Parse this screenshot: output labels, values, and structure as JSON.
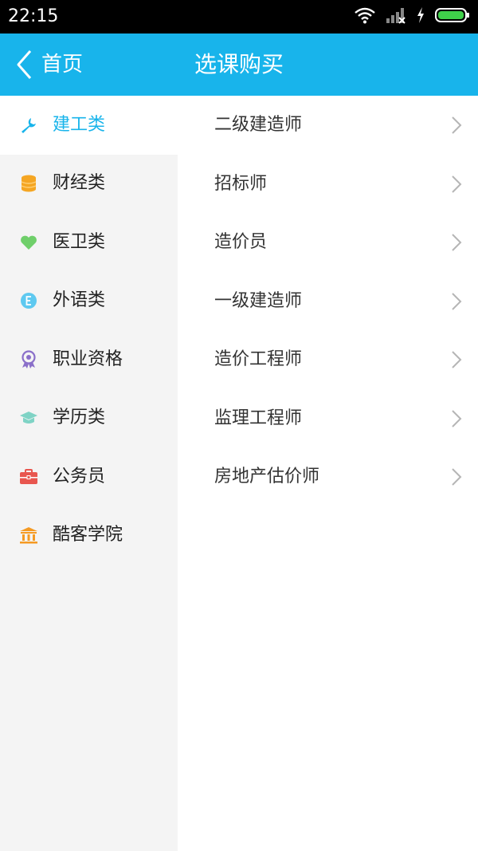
{
  "status_bar": {
    "time": "22:15",
    "icons": [
      "wifi-icon",
      "signal-icon",
      "charging-icon",
      "battery-icon"
    ]
  },
  "navbar": {
    "back_label": "首页",
    "title": "选课购买",
    "background": "#18b4eb"
  },
  "categories": [
    {
      "label": "建工类",
      "icon": "wrench-icon",
      "icon_color": "#18b4eb",
      "active": true
    },
    {
      "label": "财经类",
      "icon": "coins-icon",
      "icon_color": "#f5a623",
      "active": false
    },
    {
      "label": "医卫类",
      "icon": "heart-icon",
      "icon_color": "#6fcf6a",
      "active": false
    },
    {
      "label": "外语类",
      "icon": "letter-e-icon",
      "icon_color": "#5ec9f0",
      "active": false
    },
    {
      "label": "职业资格",
      "icon": "medal-icon",
      "icon_color": "#8a6fc9",
      "active": false
    },
    {
      "label": "学历类",
      "icon": "graduation-cap-icon",
      "icon_color": "#7fd3c5",
      "active": false
    },
    {
      "label": "公务员",
      "icon": "briefcase-icon",
      "icon_color": "#e8564f",
      "active": false
    },
    {
      "label": "酷客学院",
      "icon": "institution-icon",
      "icon_color": "#f59a23",
      "active": false
    }
  ],
  "courses": [
    {
      "label": "二级建造师"
    },
    {
      "label": "招标师"
    },
    {
      "label": "造价员"
    },
    {
      "label": "一级建造师"
    },
    {
      "label": "造价工程师"
    },
    {
      "label": "监理工程师"
    },
    {
      "label": "房地产估价师"
    }
  ],
  "colors": {
    "accent": "#18b4eb",
    "sidebar_bg": "#f4f4f4",
    "text": "#333333"
  }
}
